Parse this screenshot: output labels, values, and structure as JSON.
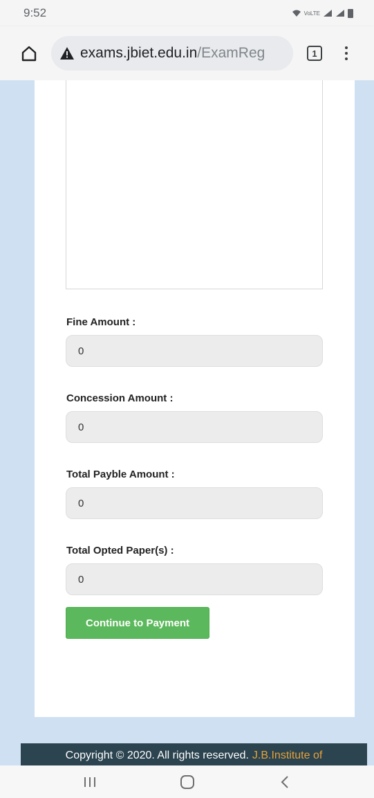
{
  "status_bar": {
    "time": "9:52",
    "network_label": "VoLTE"
  },
  "browser": {
    "url_host": "exams.jbiet.edu.in",
    "url_path": "/ExamReg",
    "tab_count": "1",
    "security_icon": "warning-triangle-icon"
  },
  "form": {
    "fields": [
      {
        "label": "Fine Amount :",
        "value": "0"
      },
      {
        "label": "Concession Amount :",
        "value": "0"
      },
      {
        "label": "Total Payble Amount :",
        "value": "0"
      },
      {
        "label": "Total Opted Paper(s) :",
        "value": "0"
      }
    ],
    "submit_label": "Continue to Payment"
  },
  "footer": {
    "copyright": "Copyright © 2020. All rights reserved.",
    "institution": "J.B.Institute of"
  },
  "colors": {
    "page_background": "#cfe0f3",
    "button_green": "#5cb85c",
    "footer_background": "#2c4450",
    "footer_brand": "#e5a23a"
  }
}
